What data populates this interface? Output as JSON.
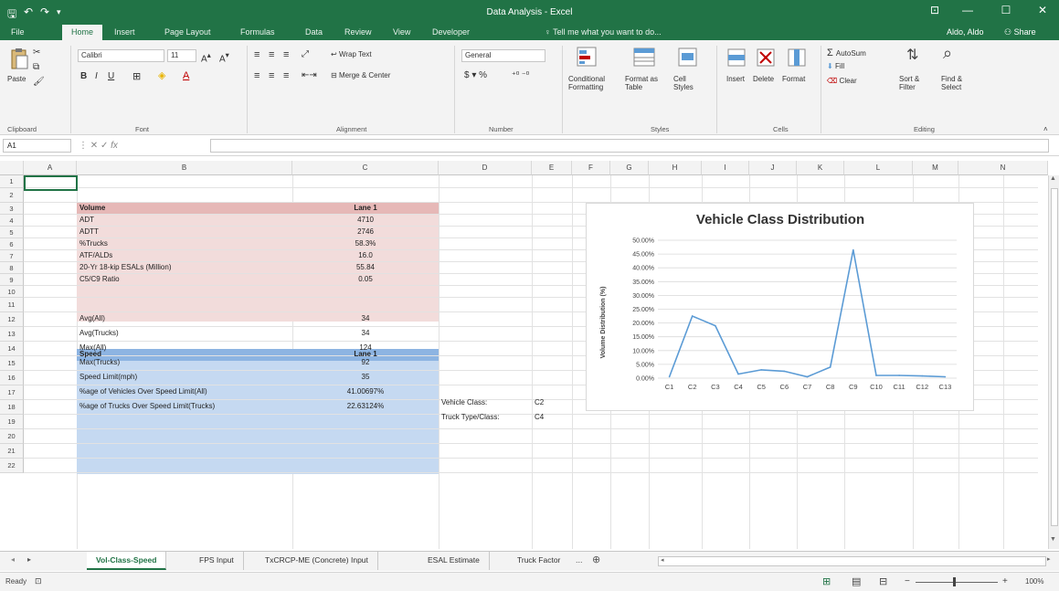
{
  "window": {
    "title": "Data Analysis - Excel",
    "accent": "#217346",
    "ribbon_display_icon": "⊡",
    "min_icon": "—",
    "max_icon": "☐",
    "close_icon": "✕"
  },
  "tabs": [
    "File",
    "Home",
    "Insert",
    "Page Layout",
    "Formulas",
    "Data",
    "Review",
    "View",
    "Developer"
  ],
  "tell_me": "Tell me what you want to do...",
  "user": "Aldo, Aldo",
  "share": "Share",
  "ribbon": {
    "paste": "Paste",
    "clipboard": "Clipboard",
    "font_name": "Calibri",
    "font_size": "11",
    "font": "Font",
    "wrap_text": "Wrap Text",
    "merge_center": "Merge & Center",
    "alignment": "Alignment",
    "number_format": "General",
    "number": "Number",
    "conditional_formatting": "Conditional Formatting",
    "format_as_table": "Format as Table",
    "cell_styles": "Cell Styles",
    "styles": "Styles",
    "insert": "Insert",
    "delete": "Delete",
    "format": "Format",
    "cells": "Cells",
    "autosum": "AutoSum",
    "fill": "Fill",
    "clear": "Clear",
    "sort_filter": "Sort & Filter",
    "find_select": "Find & Select",
    "editing": "Editing"
  },
  "formula_bar": {
    "name_box": "A1",
    "formula": ""
  },
  "columns": [
    "A",
    "B",
    "C",
    "D",
    "E",
    "F",
    "G",
    "H",
    "I",
    "J",
    "K",
    "L",
    "M",
    "N"
  ],
  "rows": [
    "1",
    "2",
    "3",
    "4",
    "5",
    "6",
    "7",
    "8",
    "9",
    "10",
    "11",
    "12",
    "13",
    "14",
    "15",
    "16",
    "17",
    "18",
    "19",
    "20",
    "21",
    "22"
  ],
  "volume_table": {
    "header": [
      "Volume",
      "Lane 1"
    ],
    "rows": [
      [
        "ADT",
        "4710"
      ],
      [
        "ADTT",
        "2746"
      ],
      [
        "%Trucks",
        "58.3%"
      ],
      [
        "ATF/ALDs",
        "16.0"
      ],
      [
        "20-Yr 18-kip ESALs (Million)",
        "55.84"
      ],
      [
        "C5/C9 Ratio",
        "0.05"
      ]
    ]
  },
  "speed_table": {
    "header": [
      "Speed",
      "Lane 1"
    ],
    "rows": [
      [
        "Avg(All)",
        "34"
      ],
      [
        "Avg(Trucks)",
        "34"
      ],
      [
        "Max(All)",
        "124"
      ],
      [
        "Max(Trucks)",
        "92"
      ],
      [
        "Speed Limit(mph)",
        "35"
      ],
      [
        "%age of Vehicles Over Speed Limit(All)",
        "41.00697%"
      ],
      [
        "%age of Trucks Over Speed Limit(Trucks)",
        "22.63124%"
      ]
    ]
  },
  "side_labels": [
    [
      "Vehicle Class:",
      "C2"
    ],
    [
      "Truck Type/Class:",
      "C4"
    ]
  ],
  "chart_data": {
    "type": "line",
    "title": "Vehicle Class Distribution",
    "ylabel": "Volume Distribution (%)",
    "xlabel": "",
    "categories": [
      "C1",
      "C2",
      "C3",
      "C4",
      "C5",
      "C6",
      "C7",
      "C8",
      "C9",
      "C10",
      "C11",
      "C12",
      "C13"
    ],
    "series": [
      {
        "values": [
          0.5,
          22.5,
          19.0,
          1.5,
          3.0,
          2.5,
          0.5,
          4.0,
          46.5,
          1.0,
          1.0,
          0.8,
          0.5
        ],
        "color": "#5b9bd5"
      }
    ],
    "ylim": [
      0,
      50
    ],
    "yticks": [
      "0.00%",
      "5.00%",
      "10.00%",
      "15.00%",
      "20.00%",
      "25.00%",
      "30.00%",
      "35.00%",
      "40.00%",
      "45.00%",
      "50.00%"
    ],
    "grid": true
  },
  "sheet_tabs": [
    "Vol-Class-Speed",
    "FPS Input",
    "TxCRCP-ME (Concrete) Input",
    "ESAL Estimate",
    "Truck Factor",
    "..."
  ],
  "status": {
    "ready": "Ready",
    "zoom": "100%"
  },
  "colors": {
    "pink_header": "#e6b8b7",
    "pink_body": "#f2dcdb",
    "blue_header": "#8db4e2",
    "blue_body": "#c5d9f1"
  }
}
